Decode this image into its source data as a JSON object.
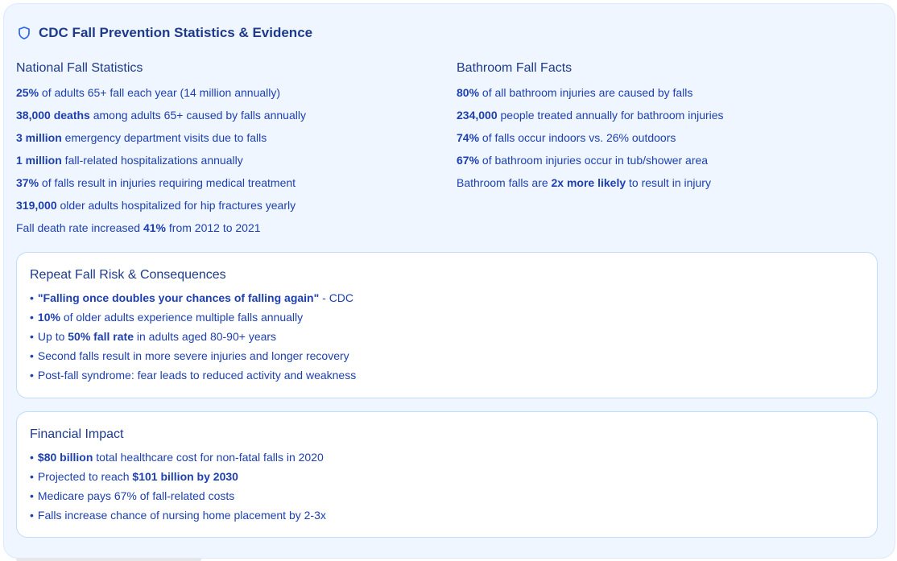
{
  "title": "CDC Fall Prevention Statistics & Evidence",
  "colors": {
    "panel_bg": "#eff6ff",
    "text": "#1e40af",
    "heading": "#1e3a8a",
    "card_border": "#bfdbfe"
  },
  "icon": "shield-icon",
  "national": {
    "heading": "National Fall Statistics",
    "items": [
      {
        "bold": "25%",
        "rest": " of adults 65+ fall each year (14 million annually)"
      },
      {
        "bold": "38,000 deaths",
        "rest": " among adults 65+ caused by falls annually"
      },
      {
        "bold": "3 million",
        "rest": " emergency department visits due to falls"
      },
      {
        "bold": "1 million",
        "rest": " fall-related hospitalizations annually"
      },
      {
        "bold": "37%",
        "rest": " of falls result in injuries requiring medical treatment"
      },
      {
        "bold": "319,000",
        "rest": " older adults hospitalized for hip fractures yearly"
      }
    ],
    "last": {
      "pre": "Fall death rate increased ",
      "bold": "41%",
      "post": " from 2012 to 2021"
    }
  },
  "bathroom": {
    "heading": "Bathroom Fall Facts",
    "items": [
      {
        "bold": "80%",
        "rest": " of all bathroom injuries are caused by falls"
      },
      {
        "bold": "234,000",
        "rest": " people treated annually for bathroom injuries"
      },
      {
        "bold": "74%",
        "rest": " of falls occur indoors vs. 26% outdoors"
      },
      {
        "bold": "67%",
        "rest": " of bathroom injuries occur in tub/shower area"
      }
    ],
    "last": {
      "pre": "Bathroom falls are ",
      "bold": "2x more likely",
      "post": " to result in injury"
    }
  },
  "repeat": {
    "heading": "Repeat Fall Risk & Consequences",
    "bullet": "•",
    "b1": {
      "bold": "\"Falling once doubles your chances of falling again\"",
      "rest": " - CDC"
    },
    "b2": {
      "bold": "10%",
      "rest": " of older adults experience multiple falls annually"
    },
    "b3": {
      "pre": "Up to ",
      "bold": "50% fall rate",
      "post": " in adults aged 80-90+ years"
    },
    "b4": "Second falls result in more severe injuries and longer recovery",
    "b5": "Post-fall syndrome: fear leads to reduced activity and weakness"
  },
  "finance": {
    "heading": "Financial Impact",
    "bullet": "•",
    "b1": {
      "bold": "$80 billion",
      "rest": " total healthcare cost for non-fatal falls in 2020"
    },
    "b2": {
      "pre": "Projected to reach ",
      "bold": "$101 billion by 2030"
    },
    "b3": "Medicare pays 67% of fall-related costs",
    "b4": "Falls increase chance of nursing home placement by 2-3x"
  }
}
